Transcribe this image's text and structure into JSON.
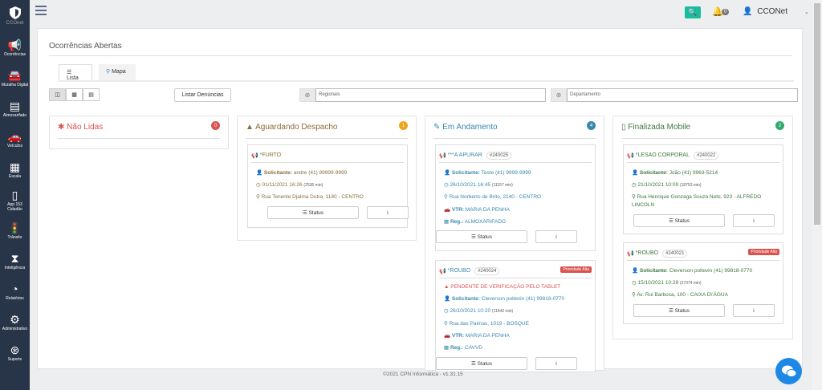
{
  "sidebar": {
    "logo_label": "CCOnet",
    "items": [
      {
        "label": "Ocorrências",
        "icon": "megaphone-icon"
      },
      {
        "label": "Muralha Digital",
        "icon": "car-camera-icon"
      },
      {
        "label": "Almoxarifado",
        "icon": "archive-icon"
      },
      {
        "label": "Veículos",
        "icon": "car-icon"
      },
      {
        "label": "Escala",
        "icon": "calendar-icon"
      },
      {
        "label": "App 153 Cidadão",
        "icon": "mobile-icon"
      },
      {
        "label": "Trânsito",
        "icon": "traffic-light-icon"
      },
      {
        "label": "Inteligência",
        "icon": "hourglass-icon"
      },
      {
        "label": "Relatórios",
        "icon": "pie-chart-icon"
      },
      {
        "label": "Administrativo",
        "icon": "gears-icon"
      },
      {
        "label": "Suporte",
        "icon": "lifebuoy-icon"
      }
    ]
  },
  "topbar": {
    "notifications": "0",
    "user": "CCONet"
  },
  "page": {
    "title": "Ocorrências Abertas",
    "tabs": [
      "Lista",
      "Mapa"
    ],
    "listar_button": "Listar Denúncias",
    "regionais_placeholder": "Regionais",
    "departamento_placeholder": "Departamento",
    "clear_glyph": "⊗"
  },
  "columns": [
    {
      "title": "Não Lidas",
      "count": "0",
      "color": "#d9534f",
      "icon": "✱"
    },
    {
      "title": "Aguardando Despacho",
      "count": "1",
      "color": "#f0a41c",
      "icon": "▲"
    },
    {
      "title": "Em Andamento",
      "count": "4",
      "color": "#3a87ad",
      "icon": "✎"
    },
    {
      "title": "Finalizada Mobile",
      "count": "2",
      "color": "#2eaa6d",
      "icon": "▯"
    }
  ],
  "labels": {
    "solicitante": "Solicitante:",
    "vtr": "VTR:",
    "reg": "Reg.:",
    "status": "Status",
    "info": "i",
    "prioridade": "Prioridade Alta"
  },
  "cards": {
    "furto": {
      "title": "*FURTO",
      "solicitante": "andre (41) 99999-9999",
      "date": "01/11/2021 16:26",
      "ago": "(2536 min)",
      "address": "Rua Tenente Djalma Dutra, 1180 - CENTRO"
    },
    "apurar": {
      "title": "***A APURAR",
      "num": "#240025",
      "solicitante": "Teste (41) 9999-9999",
      "date": "26/10/2021 16:45",
      "ago": "(11157 min)",
      "address": "Rua Norberto de Brito, 2140 - CENTRO",
      "vtr": "MARIA DA PENHA",
      "reg": "ALMOXARIFADO"
    },
    "roubo1": {
      "title": "*ROUBO",
      "num": "#240024",
      "pendente": "PENDENTE DE VERIFICAÇÃO PELO TABLET",
      "solicitante": "Cleverson poltevin (41) 99818-0770",
      "date": "26/10/2021 10:20",
      "ago": "(11542 min)",
      "address": "Rua das Palmas, 1019 - BOSQUE",
      "vtr": "MARIA DA PENHA",
      "reg": "CAVVD"
    },
    "lesao": {
      "title": "*LESAO CORPORAL",
      "num": "#240022",
      "solicitante": "João (41) 9963-5214",
      "date": "21/10/2021 10:09",
      "ago": "(18753 min)",
      "address": "Rua Henrique Gonzaga Souza Neto, 923 - ALFREDO LINCOLN"
    },
    "roubo2": {
      "title": "*ROUBO",
      "num": "#240021",
      "solicitante": "Cleverson poltevin (41) 99818-0770",
      "date": "15/10/2021 10:28",
      "ago": "(27374 min)",
      "address": "Av. Rui Barbosa, 100 - CAIXA D\\'ÁGUA"
    }
  },
  "footer": "©2021 CPN Informática - v1.31.15"
}
